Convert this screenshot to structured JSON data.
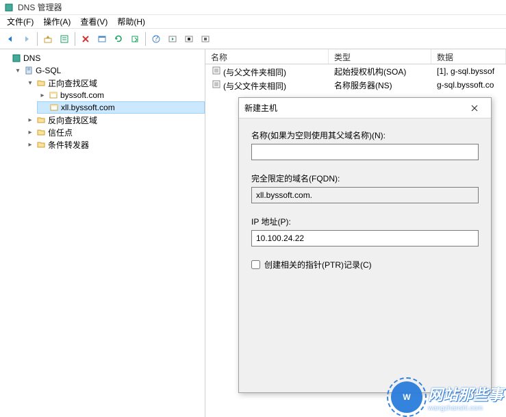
{
  "window": {
    "title": "DNS 管理器"
  },
  "menu": {
    "file": "文件(F)",
    "action": "操作(A)",
    "view": "查看(V)",
    "help": "帮助(H)"
  },
  "tree": {
    "root": "DNS",
    "server": "G-SQL",
    "fwd_zone": "正向查找区域",
    "byssoft": "byssoft.com",
    "xll": "xll.byssoft.com",
    "rev_zone": "反向查找区域",
    "trust": "信任点",
    "cond_fwd": "条件转发器"
  },
  "list": {
    "columns": {
      "name": "名称",
      "type": "类型",
      "data": "数据"
    },
    "rows": [
      {
        "name": "(与父文件夹相同)",
        "type": "起始授权机构(SOA)",
        "data": "[1], g-sql.byssof"
      },
      {
        "name": "(与父文件夹相同)",
        "type": "名称服务器(NS)",
        "data": "g-sql.byssoft.co"
      }
    ]
  },
  "dialog": {
    "title": "新建主机",
    "name_label": "名称(如果为空则使用其父域名称)(N):",
    "name_value": "",
    "fqdn_label": "完全限定的域名(FQDN):",
    "fqdn_value": "xll.byssoft.com.",
    "ip_label": "IP 地址(P):",
    "ip_value": "10.100.24.22",
    "ptr_label": "创建相关的指针(PTR)记录(C)"
  },
  "watermark": {
    "text": "网站那些事",
    "sub": "wangzhanshi.com",
    "logo": "W"
  }
}
